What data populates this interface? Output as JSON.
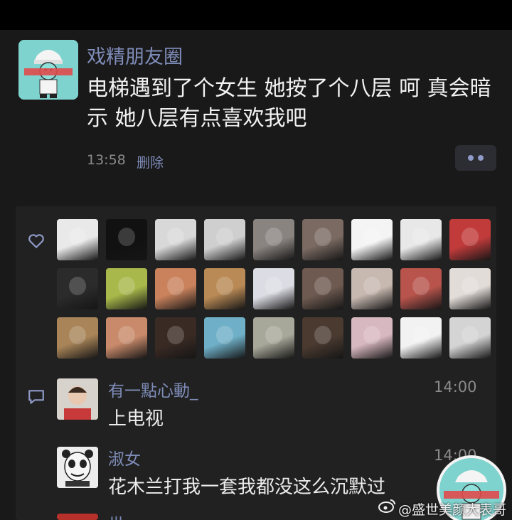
{
  "post": {
    "author": "戏精朋友圈",
    "text": "电梯遇到了个女生 她按了个八层 呵 真会暗示 她八层有点喜欢我吧",
    "time": "13:58",
    "delete_label": "删除"
  },
  "likes": {
    "avatars": [
      {
        "name": "avatar-sketch-boy",
        "color": "#e9e9e9"
      },
      {
        "name": "avatar-black-white",
        "color": "#111111"
      },
      {
        "name": "avatar-manga-girl",
        "color": "#d8d8d8"
      },
      {
        "name": "avatar-anime-girl-bw",
        "color": "#cfcfcf"
      },
      {
        "name": "avatar-grey-toy",
        "color": "#8a8480"
      },
      {
        "name": "avatar-selfie-girl",
        "color": "#7a6a62"
      },
      {
        "name": "avatar-cartoon-cup",
        "color": "#f4f4f4"
      },
      {
        "name": "avatar-panda-meme",
        "color": "#e8e8e8"
      },
      {
        "name": "avatar-man-red",
        "color": "#c23b3b"
      },
      {
        "name": "avatar-teddy-bear",
        "color": "#2b2b2b"
      },
      {
        "name": "avatar-anime-blonde",
        "color": "#a8b84a"
      },
      {
        "name": "avatar-anime-redhead",
        "color": "#c9825c"
      },
      {
        "name": "avatar-orange-cat",
        "color": "#b98a55"
      },
      {
        "name": "avatar-white-hood",
        "color": "#dcdce4"
      },
      {
        "name": "avatar-bed-photo",
        "color": "#6e5a50"
      },
      {
        "name": "avatar-white-cat",
        "color": "#c7b8b0"
      },
      {
        "name": "avatar-red-girl",
        "color": "#b8544c"
      },
      {
        "name": "avatar-dark-hair-girl",
        "color": "#e2dcd8"
      },
      {
        "name": "avatar-tabby-cat",
        "color": "#a88458"
      },
      {
        "name": "avatar-anime-boy",
        "color": "#c88a6a"
      },
      {
        "name": "avatar-man-portrait",
        "color": "#3a2a24"
      },
      {
        "name": "avatar-crayon-shin",
        "color": "#6fb0c8"
      },
      {
        "name": "avatar-panda-face",
        "color": "#a8a89a"
      },
      {
        "name": "avatar-man-dark",
        "color": "#4a3a30"
      },
      {
        "name": "avatar-pink-girl",
        "color": "#d8b8c0"
      },
      {
        "name": "avatar-smiley-circle",
        "color": "#f2f2f2"
      },
      {
        "name": "avatar-black-hair",
        "color": "#d4d4d4"
      }
    ]
  },
  "comments": [
    {
      "name": "有一點心動_",
      "text": "上电视",
      "time": "14:00",
      "avatar_color": "#cfc8c2"
    },
    {
      "name": "淑女",
      "text": "花木兰打我一套我都没这么沉默过",
      "time": "14:00",
      "avatar_color": "#e8e8e8"
    },
    {
      "name": "世",
      "text": "",
      "time": "",
      "avatar_color": "#b8302a"
    }
  ],
  "watermark": {
    "text": "@盛世美颜大表哥"
  },
  "colors": {
    "background": "#191919",
    "panel": "#212121",
    "link": "#7e8cb8",
    "avatar_teal": "#7fd3cf"
  },
  "icons": {
    "like": "heart-outline-icon",
    "comment": "comment-bubble-icon",
    "more": "more-dots-icon",
    "weibo": "weibo-logo-icon"
  }
}
